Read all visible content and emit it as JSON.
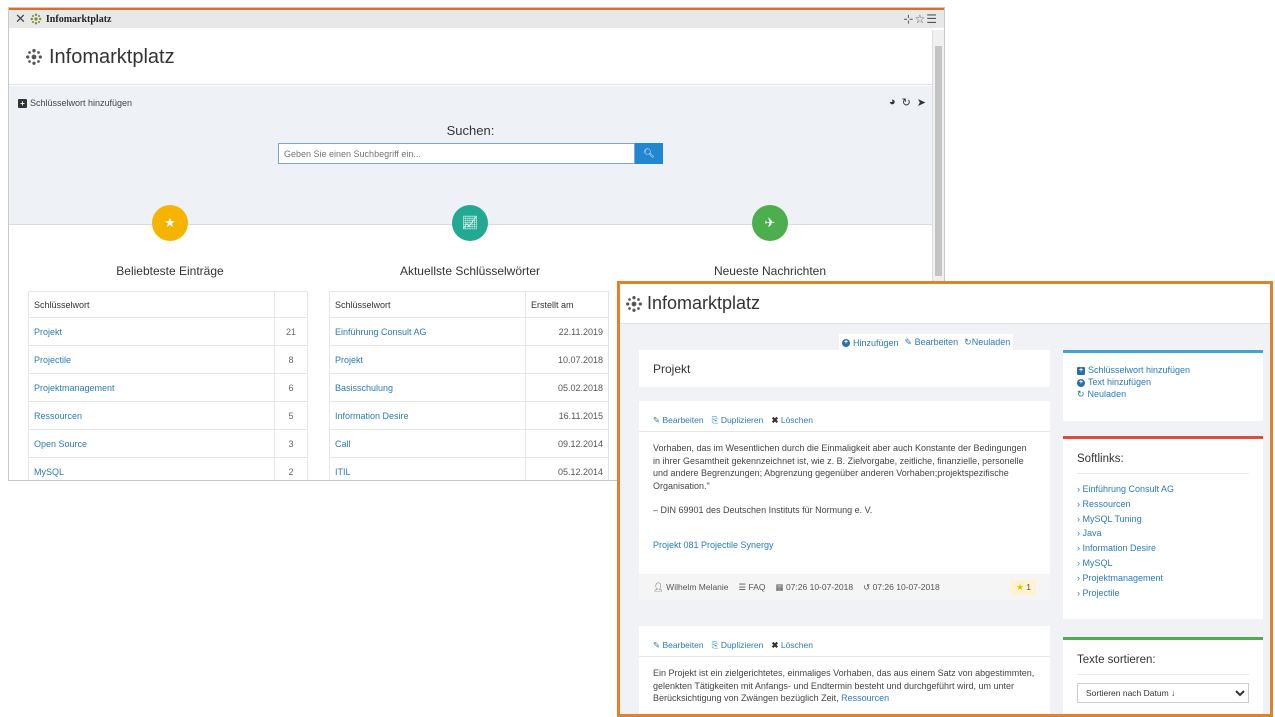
{
  "win1": {
    "title": "Infomarktplatz",
    "brand": "Infomarktplatz",
    "add_keyword": "Schlüsselwort hinzufügen",
    "search_label": "Suchen:",
    "search_placeholder": "Geben Sie einen Suchbegriff ein...",
    "columns": [
      {
        "title": "Beliebteste Einträge",
        "color": "#f4b400"
      },
      {
        "title": "Aktuellste Schlüsselwörter",
        "color": "#22a992"
      },
      {
        "title": "Neueste Nachrichten",
        "color": "#4cae4c"
      }
    ],
    "popular": {
      "header": "Schlüsselwort",
      "rows": [
        {
          "name": "Projekt",
          "count": "21"
        },
        {
          "name": "Projectile",
          "count": "8"
        },
        {
          "name": "Projektmanagement",
          "count": "6"
        },
        {
          "name": "Ressourcen",
          "count": "5"
        },
        {
          "name": "Open Source",
          "count": "3"
        },
        {
          "name": "MySQL",
          "count": "2"
        }
      ]
    },
    "recent": {
      "header_kw": "Schlüsselwort",
      "header_date": "Erstellt am",
      "rows": [
        {
          "name": "Einführung Consult AG",
          "date": "22.11.2019"
        },
        {
          "name": "Projekt",
          "date": "10.07.2018"
        },
        {
          "name": "Basisschulung",
          "date": "05.02.2018"
        },
        {
          "name": "Information Desire",
          "date": "16.11.2015"
        },
        {
          "name": "Call",
          "date": "09.12.2014"
        },
        {
          "name": "ITIL",
          "date": "05.12.2014"
        }
      ]
    }
  },
  "win2": {
    "brand": "Infomarktplatz",
    "tabs": {
      "add": "Hinzufügen",
      "edit": "Bearbeiten",
      "reload": "Neuladen"
    },
    "page_title": "Projekt",
    "actions": {
      "edit": "Bearbeiten",
      "duplicate": "Duplizieren",
      "delete": "Löschen"
    },
    "entry1": {
      "text": "Vorhaben, das im Wesentlichen durch die Einmaligkeit aber auch Konstante der Bedingungen in ihrer Gesamtheit gekennzeichnet ist, wie z. B. Zielvorgabe, zeitliche, finanzielle, personelle und andere Begrenzungen; Abgrenzung gegenüber anderen Vorhaben;projektspezifische Organisation.\"",
      "quote": "– DIN 69901 des Deutschen Instituts für Normung e. V.",
      "link": "Projekt 081 Projectile Synergy",
      "author": "Wilhelm Melanie",
      "category": "FAQ",
      "created": "07:26 10-07-2018",
      "modified": "07:26 10-07-2018",
      "stars": "1"
    },
    "entry2": {
      "text": "Ein Projekt ist ein zielgerichtetes, einmaliges Vorhaben, das aus einem Satz von abgestimmten, gelenkten Tätigkeiten mit Anfangs- und Endtermin besteht und durchgeführt wird, um unter Berücksichtigung von Zwängen bezüglich Zeit,",
      "link": "Ressourcen"
    },
    "side_links": {
      "add_keyword": "Schlüsselwort hinzufügen",
      "add_text": "Text hinzufügen",
      "reload": "Neuladen"
    },
    "softlinks_title": "Softlinks:",
    "softlinks": [
      "Einführung Consult AG",
      "Ressourcen",
      "MySQL Tuning",
      "Java",
      "Information Desire",
      "MySQL",
      "Projektmanagement",
      "Projectile"
    ],
    "sort_title": "Texte sortieren:",
    "sort_selected": "Sortieren nach Datum ↓"
  }
}
